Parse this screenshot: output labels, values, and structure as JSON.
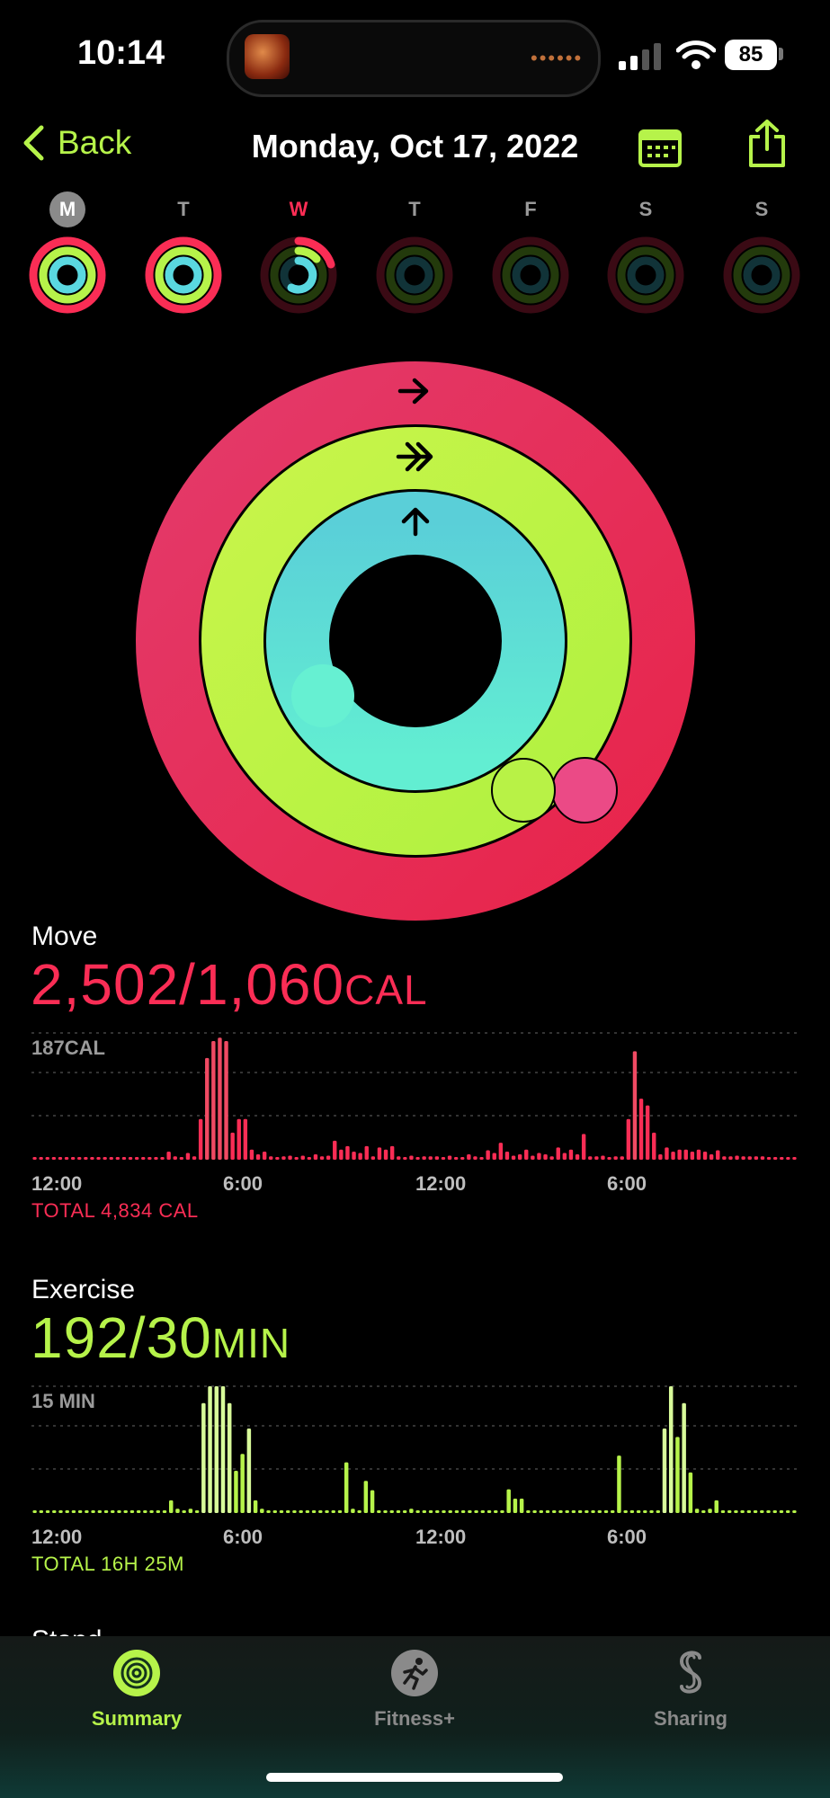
{
  "status_bar": {
    "time": "10:14",
    "battery": "85",
    "island_dots": "••••••"
  },
  "header": {
    "back_label": "Back",
    "date": "Monday, Oct 17, 2022"
  },
  "week": [
    {
      "label": "M",
      "state": "today"
    },
    {
      "label": "T",
      "state": "normal"
    },
    {
      "label": "W",
      "state": "highlight"
    },
    {
      "label": "T",
      "state": "normal"
    },
    {
      "label": "F",
      "state": "normal"
    },
    {
      "label": "S",
      "state": "normal"
    },
    {
      "label": "S",
      "state": "normal"
    }
  ],
  "colors": {
    "move": "#fa2d55",
    "exercise": "#b6f34a",
    "stand": "#5ad8e0",
    "accent": "#b6f34a"
  },
  "move": {
    "title": "Move",
    "value": "2,502/1,060",
    "unit": "CAL",
    "top_label": "187CAL",
    "total": "TOTAL 4,834 CAL"
  },
  "exercise": {
    "title": "Exercise",
    "value": "192/30",
    "unit": "MIN",
    "top_label": "15 MIN",
    "total": "TOTAL 16H 25M"
  },
  "stand_peek": "Stand",
  "axis_ticks": [
    "12:00",
    "6:00",
    "12:00",
    "6:00"
  ],
  "chart_data": [
    {
      "type": "bar",
      "name": "move",
      "unit": "CAL",
      "ylim": [
        0,
        187
      ],
      "values": [
        3,
        3,
        3,
        3,
        3,
        3,
        3,
        3,
        3,
        3,
        3,
        3,
        3,
        3,
        3,
        3,
        3,
        3,
        3,
        3,
        3,
        12,
        5,
        4,
        10,
        5,
        60,
        150,
        175,
        180,
        175,
        40,
        60,
        60,
        15,
        8,
        12,
        5,
        4,
        5,
        6,
        4,
        6,
        4,
        8,
        5,
        6,
        28,
        15,
        20,
        12,
        10,
        20,
        5,
        18,
        15,
        20,
        5,
        4,
        6,
        3,
        5,
        5,
        5,
        4,
        6,
        4,
        4,
        8,
        5,
        4,
        14,
        10,
        25,
        12,
        6,
        8,
        15,
        6,
        10,
        8,
        5,
        18,
        10,
        15,
        8,
        38,
        5,
        5,
        6,
        4,
        5,
        5,
        60,
        160,
        90,
        80,
        40,
        8,
        18,
        12,
        15,
        15,
        12,
        15,
        12,
        8,
        14,
        5,
        5,
        6,
        5,
        5,
        5,
        5,
        3,
        4,
        3,
        3,
        3
      ]
    },
    {
      "type": "bar",
      "name": "exercise",
      "unit": "MIN",
      "ylim": [
        0,
        15
      ],
      "values": [
        0.3,
        0.3,
        0.3,
        0.3,
        0.3,
        0.3,
        0.3,
        0.3,
        0.3,
        0.3,
        0.3,
        0.3,
        0.3,
        0.3,
        0.3,
        0.3,
        0.3,
        0.3,
        0.3,
        0.3,
        0.3,
        1.5,
        0.5,
        0.3,
        0.5,
        0.3,
        13,
        15,
        15,
        15,
        13,
        5,
        7,
        10,
        1.5,
        0.5,
        0.3,
        0.3,
        0.3,
        0.3,
        0.3,
        0.3,
        0.3,
        0.3,
        0.3,
        0.3,
        0.3,
        0.3,
        6,
        0.5,
        0.3,
        3.8,
        2.7,
        0.3,
        0.3,
        0.3,
        0.3,
        0.3,
        0.5,
        0.3,
        0.3,
        0.3,
        0.3,
        0.3,
        0.3,
        0.3,
        0.3,
        0.3,
        0.3,
        0.3,
        0.3,
        0.3,
        0.3,
        2.8,
        1.7,
        1.7,
        0.3,
        0.3,
        0.3,
        0.3,
        0.3,
        0.3,
        0.3,
        0.3,
        0.3,
        0.3,
        0.3,
        0.3,
        0.3,
        0.3,
        6.8,
        0.3,
        0.3,
        0.3,
        0.3,
        0.3,
        0.3,
        10,
        15,
        9,
        13,
        4.8,
        0.5,
        0.3,
        0.5,
        1.5,
        0.3,
        0.3,
        0.3,
        0.3,
        0.3,
        0.3,
        0.3,
        0.3,
        0.3,
        0.3,
        0.3,
        0.3
      ]
    }
  ],
  "tabs": [
    {
      "label": "Summary",
      "active": true
    },
    {
      "label": "Fitness+",
      "active": false
    },
    {
      "label": "Sharing",
      "active": false
    }
  ]
}
